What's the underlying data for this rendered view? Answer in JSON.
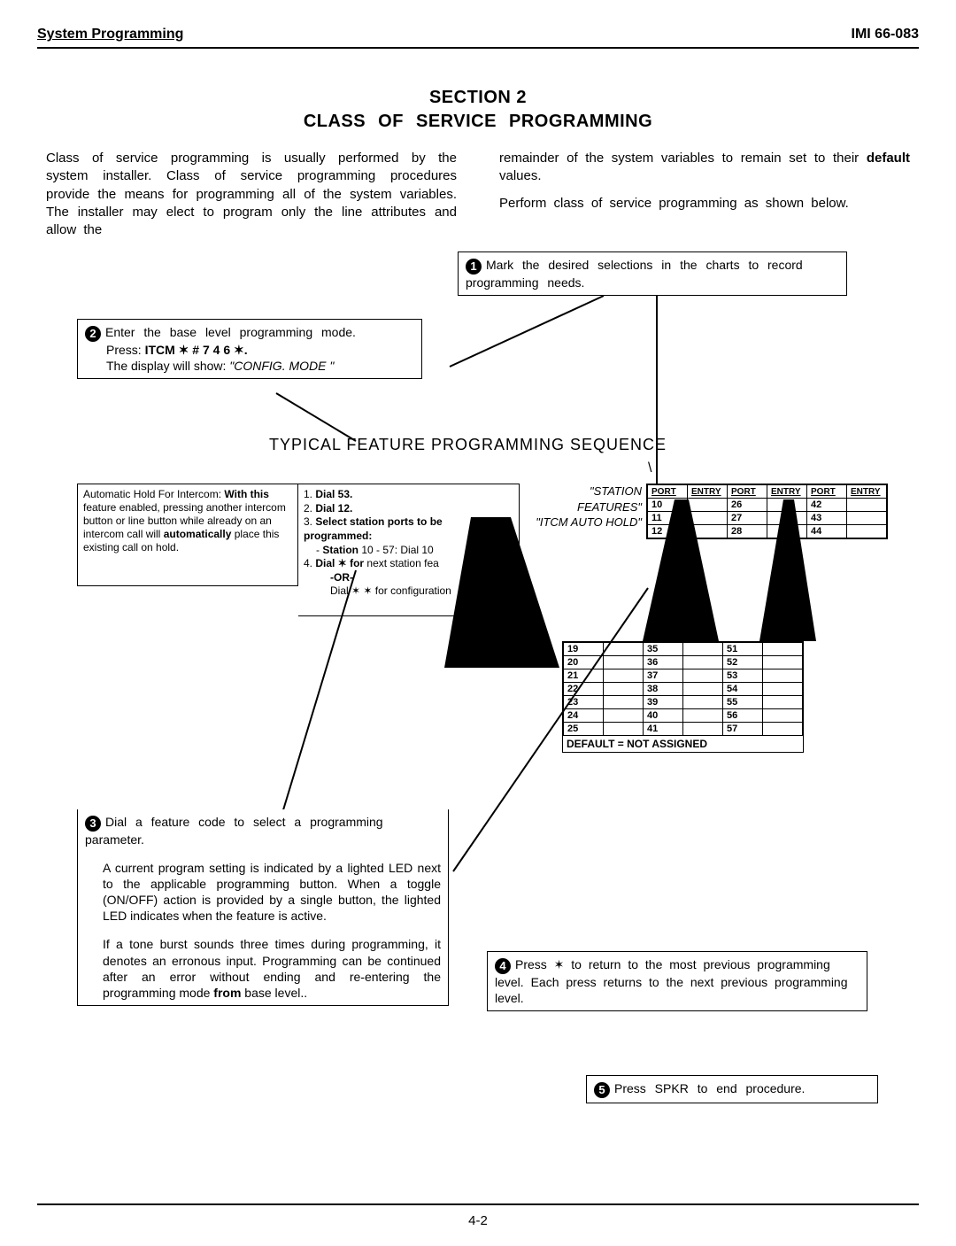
{
  "header": {
    "left": "System Programming",
    "right_prefix": "IMI",
    "right_code": "66-083"
  },
  "section": {
    "num": "SECTION 2",
    "title": "CLASS OF SERVICE PROGRAMMING"
  },
  "intro": {
    "col1": "Class of service programming is usually performed by the system installer. Class of service programming procedures provide the means for programming all of the system variables. The installer may elect to program only the line attributes and allow the",
    "col2a_pre": "remainder of the system variables to remain set to their ",
    "col2a_bold": "default",
    "col2a_post": " values.",
    "col2b": "Perform class of service programming as shown below."
  },
  "steps": {
    "s1": "Mark the desired selections in the charts to record programming needs.",
    "s2_line1": "Enter the base level programming mode.",
    "s2_line2_pre": "Press: ",
    "s2_line2_bold": "ITCM ✶ # 7 4 6 ✶.",
    "s2_line3_pre": "The display will show: ",
    "s2_line3_ital": "\"CONFIG. MODE \"",
    "s3_p1": "Dial a feature code to select a programming parameter.",
    "s3_p2": "A current program setting is indicated by a lighted LED next to the applicable programming button. When a toggle (ON/OFF) action is provided by a single button, the lighted LED indicates when the feature is active.",
    "s3_p3_pre": "If a tone burst sounds three times during programming, it denotes an erronous input. Programming can be continued after an error without ending and re-entering the programming mode ",
    "s3_p3_bold": "from",
    "s3_p3_post": " base level..",
    "s4": "Press ✶ to return to the most previous programming level. Each press returns to the next previous programming level.",
    "s5": "Press SPKR to end procedure."
  },
  "seq_title": "TYPICAL FEATURE PROGRAMMING SEQUENCE",
  "feature_desc": {
    "pre": "Automatic Hold For Intercom: ",
    "bold1": "With this",
    "mid": " feature enabled, pressing another intercom button or line button while already on an intercom call will ",
    "bold2": "automatically",
    "post": " place this existing call on hold."
  },
  "feature_steps": {
    "s1_pre": "1. ",
    "s1_bold": "Dial 53.",
    "s2_pre": "2. ",
    "s2_bold": "Dial 12.",
    "s3_pre": "3. ",
    "s3_bold": "Select station ports to be programmed:",
    "s3a_pre": "- ",
    "s3a_bold": "Station",
    "s3a_post": " 10 - 57: Dial 10",
    "s4_pre": "4. ",
    "s4_bold": "Dial ✶ for",
    "s4_post": " next station fea",
    "or": "-OR-",
    "last": "Dial ✶ ✶ for configuration"
  },
  "quote_labels": {
    "l1": "\"STATION FEATURES\"",
    "l2": "\"ITCM AUTO HOLD\""
  },
  "port_table": {
    "headers": [
      "PORT",
      "ENTRY",
      "PORT",
      "ENTRY",
      "PORT",
      "ENTRY"
    ],
    "top_rows": [
      [
        "10",
        "",
        "26",
        "",
        "42",
        ""
      ],
      [
        "11",
        "",
        "27",
        "",
        "43",
        ""
      ],
      [
        "12",
        "",
        "28",
        "",
        "44",
        ""
      ]
    ],
    "bottom_rows": [
      [
        "19",
        "",
        "35",
        "",
        "51",
        ""
      ],
      [
        "20",
        "",
        "36",
        "",
        "52",
        ""
      ],
      [
        "21",
        "",
        "37",
        "",
        "53",
        ""
      ],
      [
        "22",
        "",
        "38",
        "",
        "54",
        ""
      ],
      [
        "23",
        "",
        "39",
        "",
        "55",
        ""
      ],
      [
        "24",
        "",
        "40",
        "",
        "56",
        ""
      ],
      [
        "25",
        "",
        "41",
        "",
        "57",
        ""
      ]
    ],
    "default": "DEFAULT = NOT ASSIGNED"
  },
  "page_num": "4-2"
}
